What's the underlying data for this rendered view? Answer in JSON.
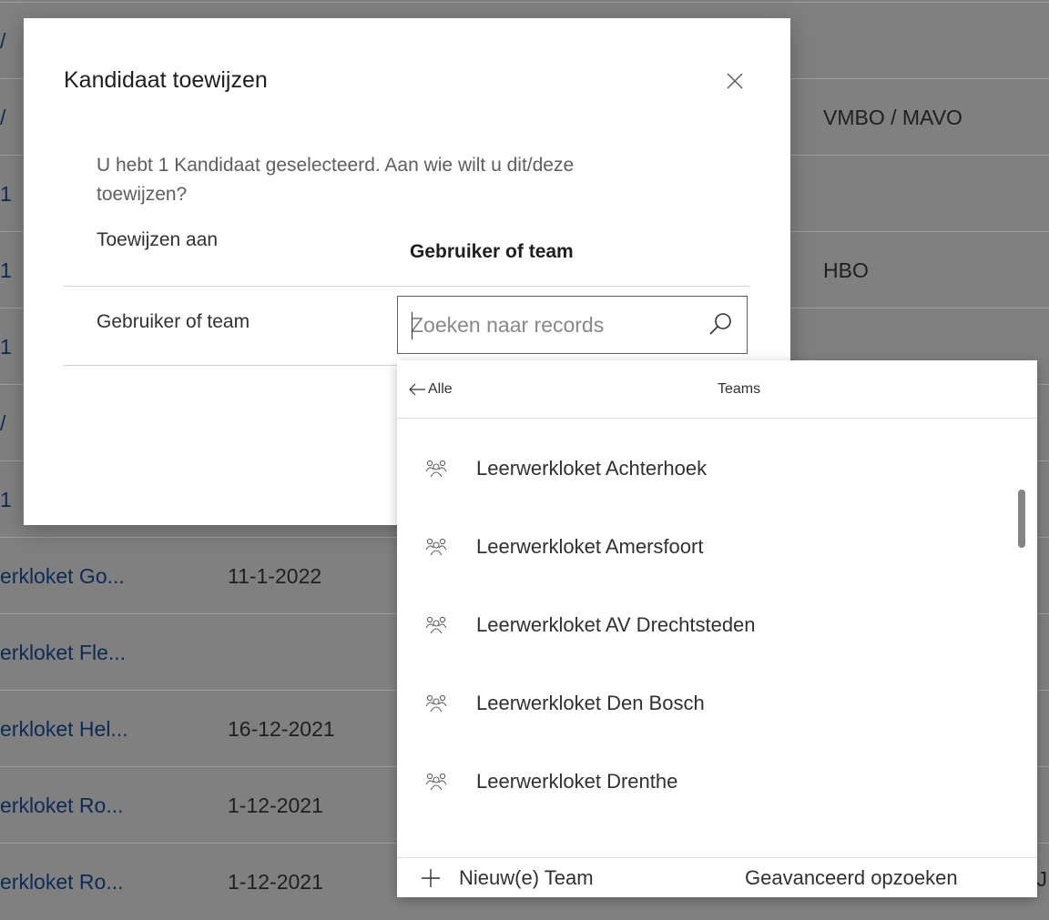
{
  "background_table": {
    "rows": [
      {
        "name": "",
        "date": "",
        "education": ""
      },
      {
        "name": "",
        "date": "",
        "education": "VMBO / MAVO"
      },
      {
        "name": "",
        "date": "",
        "education": ""
      },
      {
        "name": "",
        "date": "",
        "education": "HBO"
      },
      {
        "name": "",
        "date": "",
        "education": ""
      },
      {
        "name": "",
        "date": "",
        "education": ""
      },
      {
        "name": "",
        "date": "",
        "education": ""
      },
      {
        "name": "erkloket Go...",
        "date": "11-1-2022",
        "education": ""
      },
      {
        "name": "erkloket Fle...",
        "date": "",
        "education": ""
      },
      {
        "name": "erkloket Hel...",
        "date": "16-12-2021",
        "education": ""
      },
      {
        "name": "erkloket Ro...",
        "date": "1-12-2021",
        "education": ""
      },
      {
        "name": "erkloket Ro...",
        "date": "1-12-2021",
        "education": ""
      }
    ],
    "truncated_left_chars": [
      "/",
      "/",
      "1",
      "1",
      "1",
      "/",
      "1"
    ],
    "right_edge_char": "J"
  },
  "dialog": {
    "title": "Kandidaat toewijzen",
    "description": "U hebt 1 Kandidaat geselecteerd. Aan wie wilt u dit/deze toewijzen?",
    "assign_to_label": "Toewijzen aan",
    "assign_to_value": "Gebruiker of team",
    "field_label": "Gebruiker of team",
    "lookup": {
      "placeholder": "Zoeken naar records",
      "value": ""
    }
  },
  "dropdown": {
    "back_label": "Alle",
    "active_tab": "Teams",
    "items": [
      {
        "name": "Leerwerkloket Achterhoek",
        "icon": "team-icon"
      },
      {
        "name": "Leerwerkloket Amersfoort",
        "icon": "team-icon"
      },
      {
        "name": "Leerwerkloket AV Drechtsteden",
        "icon": "team-icon"
      },
      {
        "name": "Leerwerkloket Den Bosch",
        "icon": "team-icon"
      },
      {
        "name": "Leerwerkloket Drenthe",
        "icon": "team-icon"
      }
    ],
    "new_button_label": "Nieuw(e) Team",
    "advanced_lookup_label": "Geavanceerd opzoeken"
  },
  "colors": {
    "overlay": "#808080",
    "link_text": "#0d2a55",
    "dialog_bg": "#ffffff",
    "border": "#605e5c"
  }
}
